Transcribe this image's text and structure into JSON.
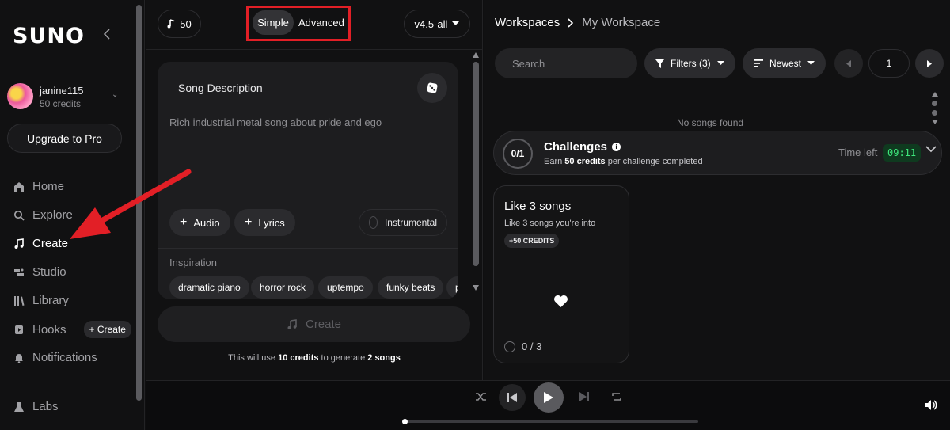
{
  "sidebar": {
    "logo": "SUNO",
    "user": {
      "name": "janine115",
      "credits": "50 credits"
    },
    "upgrade_label": "Upgrade to Pro",
    "nav": [
      {
        "label": "Home",
        "icon": "home-icon"
      },
      {
        "label": "Explore",
        "icon": "search-icon"
      },
      {
        "label": "Create",
        "icon": "music-note-icon",
        "active": true
      },
      {
        "label": "Studio",
        "icon": "studio-icon"
      },
      {
        "label": "Library",
        "icon": "library-icon"
      },
      {
        "label": "Hooks",
        "icon": "hooks-icon",
        "badge": "+ Create"
      },
      {
        "label": "Notifications",
        "icon": "bell-icon"
      },
      {
        "label": "Labs",
        "icon": "flask-icon"
      }
    ]
  },
  "create": {
    "credits": "50",
    "modes": {
      "simple": "Simple",
      "advanced": "Advanced",
      "selected": "Simple"
    },
    "model": "v4.5-all",
    "card": {
      "title": "Song Description",
      "description": "Rich industrial metal song about pride and ego",
      "audio_label": "Audio",
      "lyrics_label": "Lyrics",
      "instrumental_label": "Instrumental",
      "inspiration_label": "Inspiration",
      "tags": [
        "dramatic piano",
        "horror rock",
        "uptempo",
        "funky beats",
        "p"
      ]
    },
    "create_label": "Create",
    "notice": {
      "pre": "This will use ",
      "credits": "10 credits",
      "mid": " to generate ",
      "songs": "2 songs"
    }
  },
  "workspace": {
    "breadcrumb": {
      "root": "Workspaces",
      "current": "My Workspace"
    },
    "search_placeholder": "Search",
    "filters_label": "Filters (3)",
    "sort_label": "Newest",
    "page": "1",
    "empty_text": "No songs found",
    "challenges": {
      "count": "0/1",
      "title": "Challenges",
      "sub_pre": "Earn ",
      "sub_credits": "50 credits",
      "sub_post": " per challenge completed",
      "time_left_label": "Time left",
      "timer": "09:11"
    },
    "challenge_card": {
      "title": "Like 3 songs",
      "subtitle": "Like 3 songs you're into",
      "badge": "+50 CREDITS",
      "progress": "0 / 3"
    }
  },
  "colors": {
    "highlight_box": "#e21f26",
    "arrow": "#e21f26",
    "timer_green": "#3ee57b"
  }
}
